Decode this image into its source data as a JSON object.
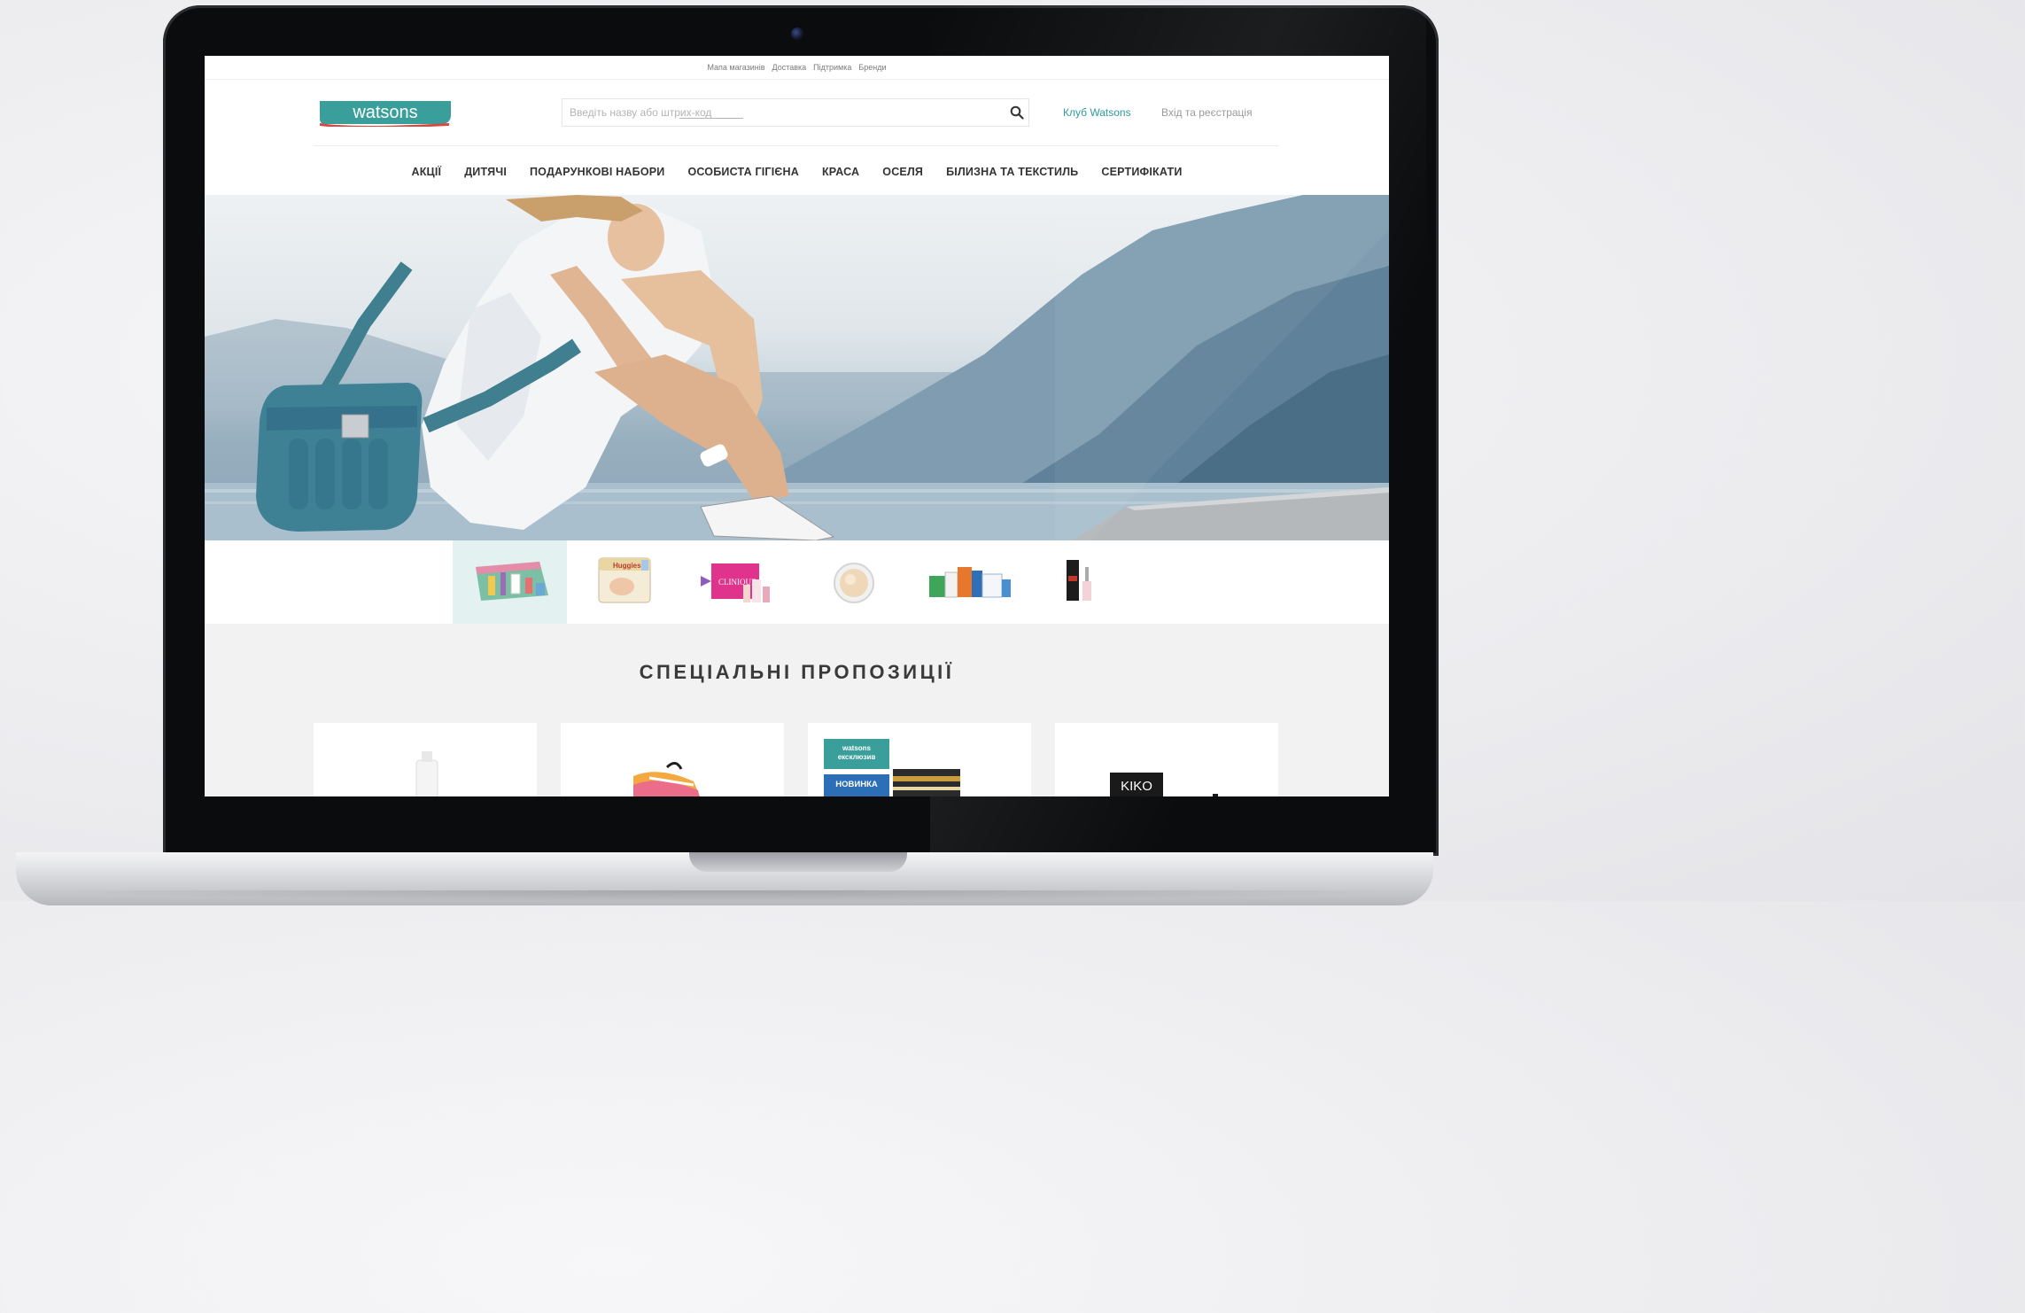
{
  "util_links": [
    "Мапа магазинів",
    "Доставка",
    "Підтримка",
    "Бренди"
  ],
  "logo": {
    "text": "watsons"
  },
  "search": {
    "placeholder_prefix": "Введіть назву або ",
    "placeholder_link": "штрих-код"
  },
  "account": {
    "club_label": "Клуб Watsons",
    "login_label": "Вхід та реєстрація"
  },
  "nav": [
    "АКЦІЇ",
    "ДИТЯЧІ",
    "ПОДАРУНКОВІ НАБОРИ",
    "ОСОБИСТА ГІГІЄНА",
    "КРАСА",
    "ОСЕЛЯ",
    "БІЛИЗНА ТА ТЕКСТИЛЬ",
    "СЕРТИФІКАТИ"
  ],
  "thumbnails": [
    "cosmetics-bag",
    "huggies-diapers",
    "clinique-set",
    "compact-powder",
    "household-products",
    "kiko-nail-polish"
  ],
  "thumb_brand_labels": {
    "huggies": "Huggies",
    "clinique": "CLINIQUE"
  },
  "offers": {
    "title": "СПЕЦІАЛЬНІ ПРОПОЗИЦІЇ",
    "badges": {
      "exclusive": "watsons ексклюзив",
      "new": "НОВИНКА"
    },
    "kiko_label": "KIKO"
  },
  "colors": {
    "brand_teal": "#3a9f9b",
    "brand_red": "#d9473f",
    "link_teal": "#2f9b9b"
  }
}
